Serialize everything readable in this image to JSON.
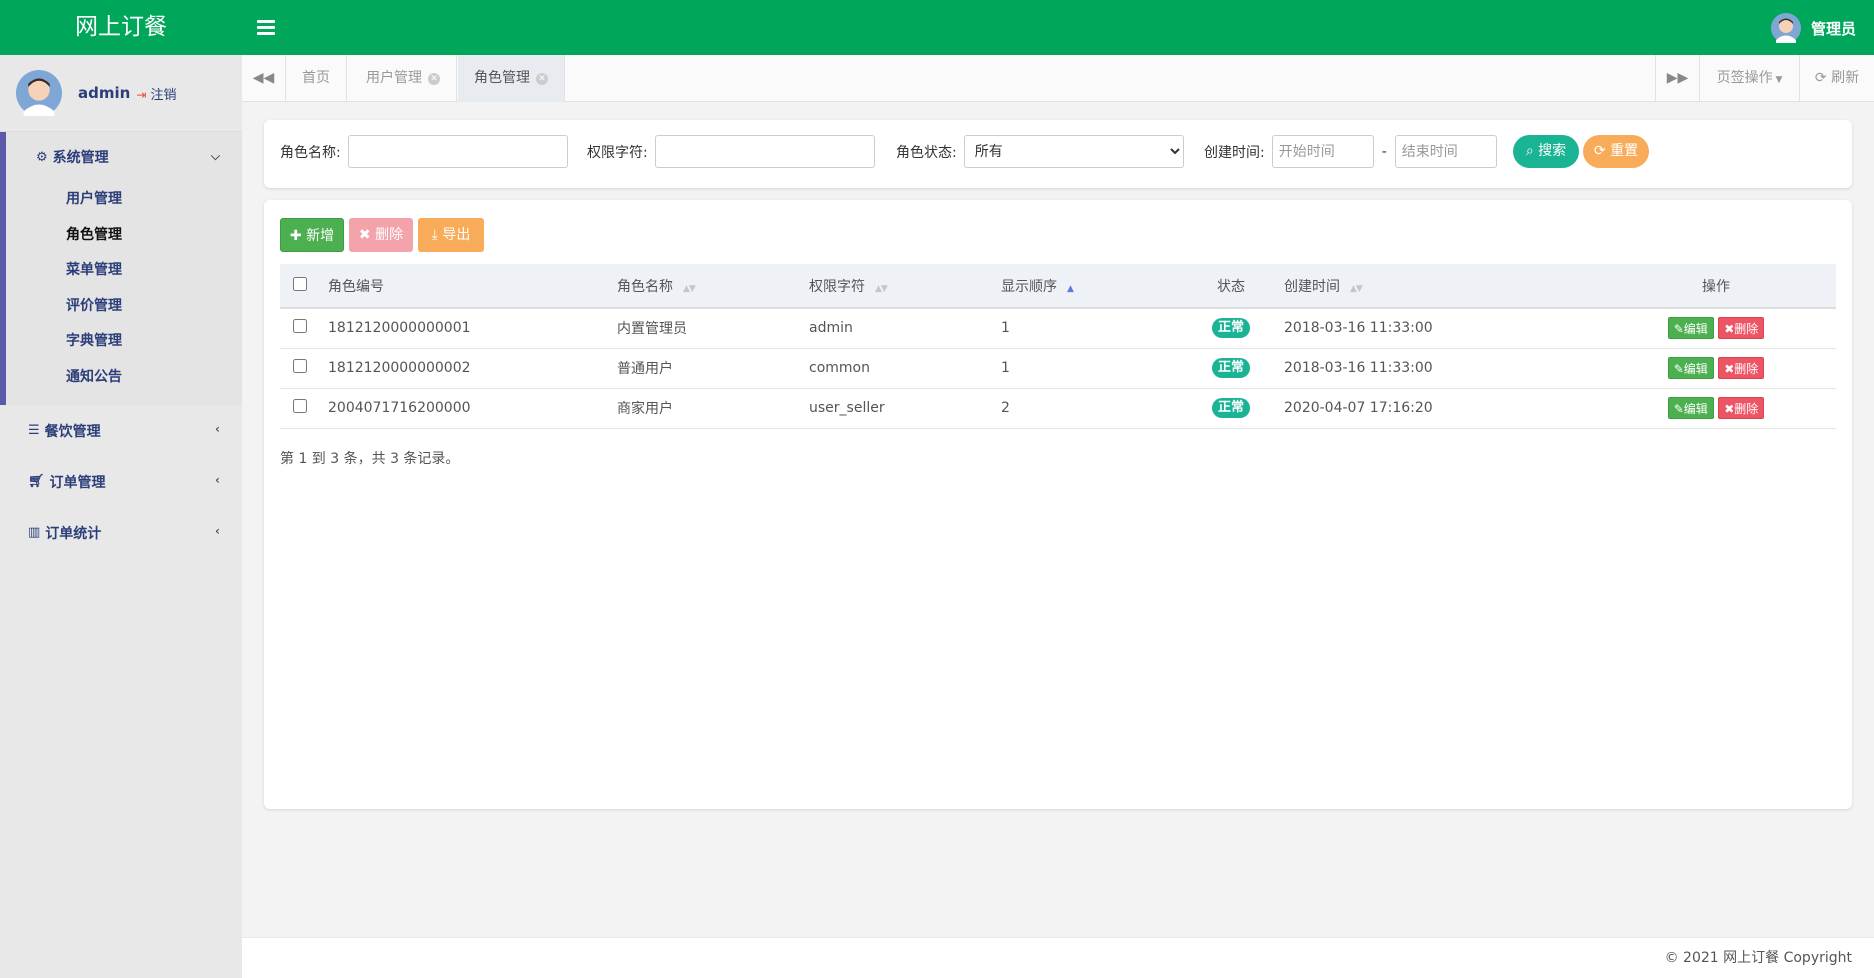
{
  "app": {
    "title": "网上订餐"
  },
  "topbar": {
    "user_label": "管理员"
  },
  "sidebar": {
    "user": {
      "name": "admin",
      "logout": "注销"
    },
    "groups": [
      {
        "label": "系统管理",
        "icon": "gear-icon",
        "items": [
          "用户管理",
          "角色管理",
          "菜单管理",
          "评价管理",
          "字典管理",
          "通知公告"
        ],
        "current": "角色管理"
      },
      {
        "label": "餐饮管理",
        "icon": "list-icon"
      },
      {
        "label": "订单管理",
        "icon": "cart-icon"
      },
      {
        "label": "订单统计",
        "icon": "bar-chart-icon"
      }
    ]
  },
  "tabs": {
    "items": [
      "首页",
      "用户管理",
      "角色管理"
    ],
    "active": "角色管理",
    "ops_label": "页签操作",
    "refresh_label": "刷新"
  },
  "search": {
    "role_name_label": "角色名称:",
    "role_name_value": "",
    "perm_label": "权限字符:",
    "perm_value": "",
    "status_label": "角色状态:",
    "status_selected": "所有",
    "created_label": "创建时间:",
    "start_placeholder": "开始时间",
    "end_placeholder": "结束时间",
    "range_sep": "-",
    "search_btn": "搜索",
    "reset_btn": "重置"
  },
  "toolbar": {
    "add": "新增",
    "delete": "删除",
    "export": "导出"
  },
  "table": {
    "columns": [
      "角色编号",
      "角色名称",
      "权限字符",
      "显示顺序",
      "状态",
      "创建时间",
      "操作"
    ],
    "rows": [
      {
        "id": "1812120000000001",
        "name": "内置管理员",
        "perm": "admin",
        "order": "1",
        "status": "正常",
        "created": "2018-03-16 11:33:00"
      },
      {
        "id": "1812120000000002",
        "name": "普通用户",
        "perm": "common",
        "order": "1",
        "status": "正常",
        "created": "2018-03-16 11:33:00"
      },
      {
        "id": "2004071716200000",
        "name": "商家用户",
        "perm": "user_seller",
        "order": "2",
        "status": "正常",
        "created": "2020-04-07 17:16:20"
      }
    ],
    "edit_label": "编辑",
    "delete_label": "删除",
    "pager_text": "第 1 到 3 条，共 3 条记录。"
  },
  "footer": {
    "text": "© 2021 网上订餐 Copyright"
  },
  "colors": {
    "brand_green": "#00a65a",
    "status_teal": "#1ab394",
    "danger": "#ed5565",
    "warning": "#f8ac59",
    "success": "#4caf50"
  }
}
